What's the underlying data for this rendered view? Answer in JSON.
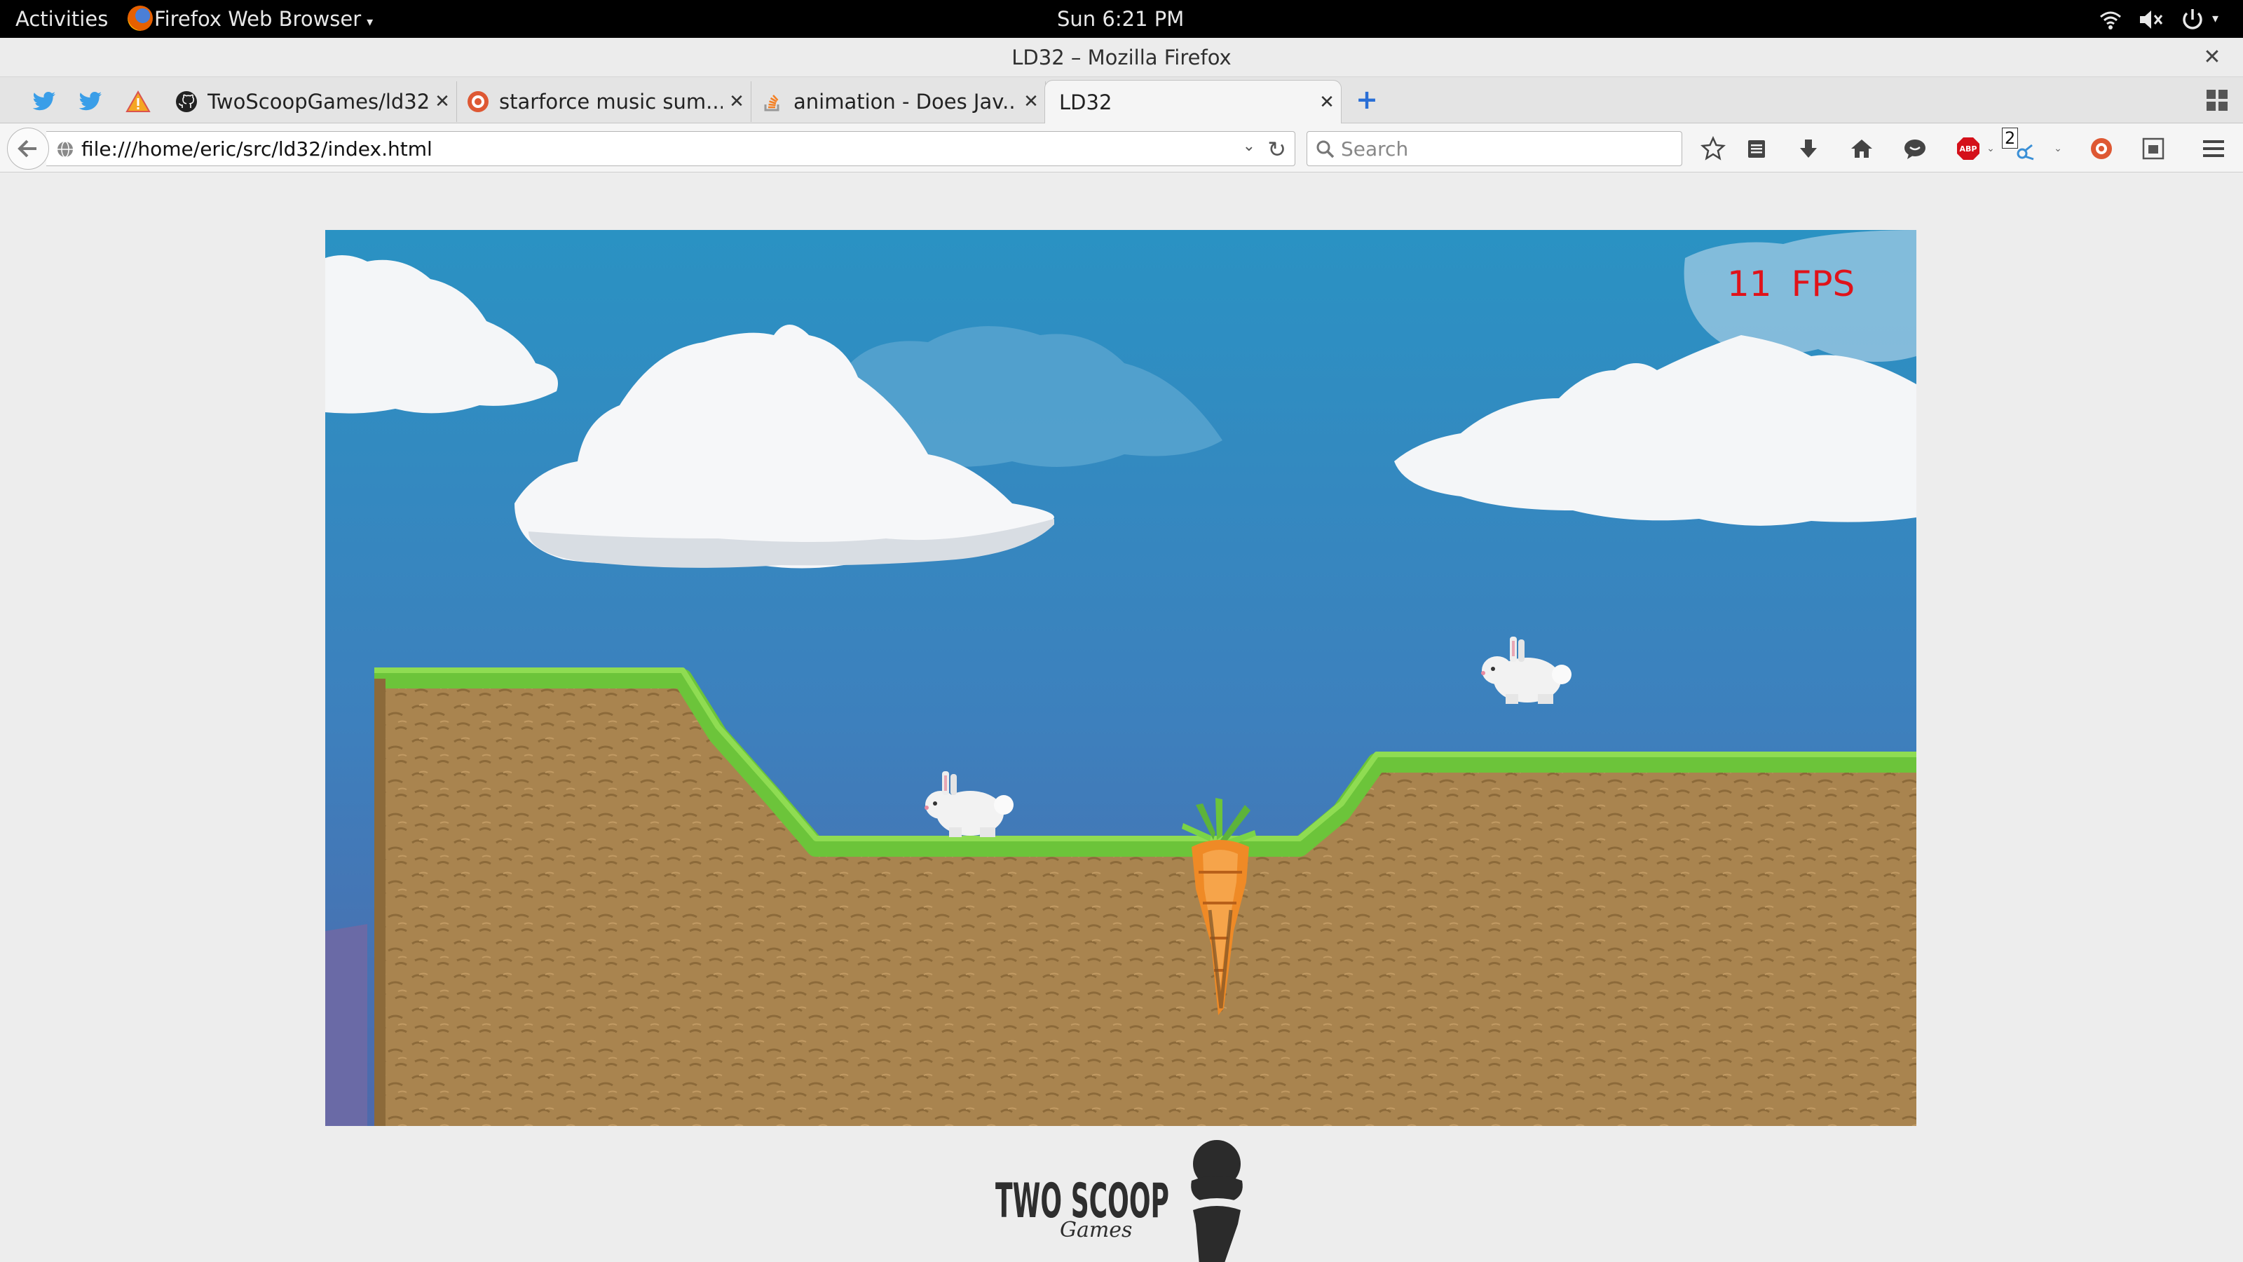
{
  "topbar": {
    "activities": "Activities",
    "app_menu": "Firefox Web Browser",
    "clock": "Sun  6:21 PM"
  },
  "window": {
    "title": "LD32 – Mozilla Firefox"
  },
  "tabs": [
    {
      "label": "TwoScoopGames/ld32",
      "icon": "github-icon"
    },
    {
      "label": "starforce music sum...",
      "icon": "duckduckgo-icon"
    },
    {
      "label": "animation - Does Jav...",
      "icon": "stackoverflow-icon"
    },
    {
      "label": "LD32",
      "icon": "none",
      "active": true
    }
  ],
  "pinned_tabs": [
    "twitter-icon",
    "twitter-icon",
    "warning-icon"
  ],
  "navbar": {
    "url": "file:///home/eric/src/ld32/index.html",
    "search_placeholder": "Search",
    "badge_count": "2"
  },
  "game": {
    "fps_value": "11",
    "fps_unit": "FPS"
  },
  "logo": {
    "text": "TWO SCOOP",
    "subtext": "Games"
  },
  "colors": {
    "sky_top": "#2c8fc1",
    "sky_bottom": "#4a71b0",
    "grass": "#6cc43a",
    "dirt": "#a9844f",
    "carrot": "#ef8a26",
    "fps": "#e0131a"
  }
}
